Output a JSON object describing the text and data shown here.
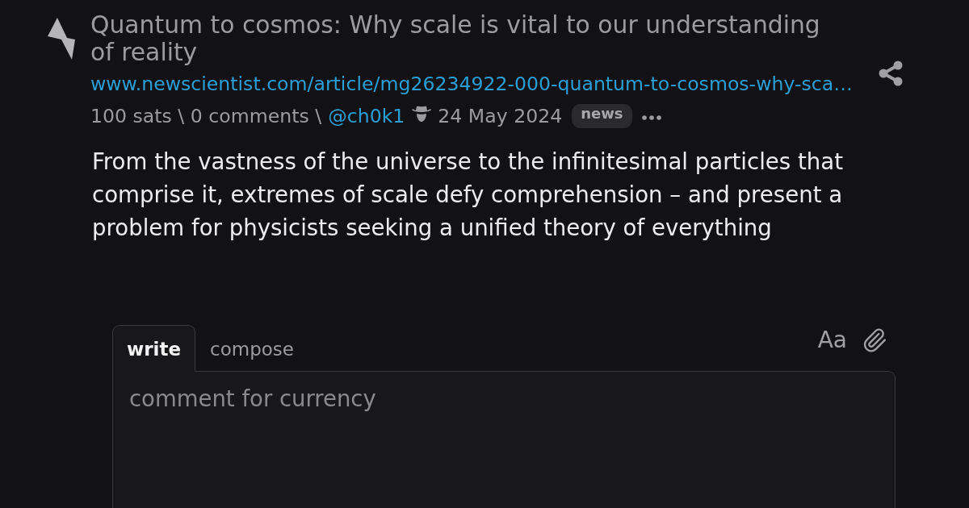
{
  "post": {
    "title": "Quantum to cosmos: Why scale is vital to our understanding of reality",
    "url": "www.newscientist.com/article/mg26234922-000-quantum-to-cosmos-why-sca…",
    "stats": "100 sats \\ 0 comments \\",
    "author": "@ch0k1",
    "date": "24 May 2024",
    "tag": "news"
  },
  "body": "From the vastness of the universe to the infinitesimal particles that comprise it, extremes of scale defy comprehension – and present a problem for physicists seeking a unified theory of everything",
  "reply": {
    "tabs": [
      {
        "label": "write",
        "selected": true
      },
      {
        "label": "compose",
        "selected": false
      }
    ],
    "format_toggle": "Aa",
    "placeholder": "comment for currency"
  }
}
